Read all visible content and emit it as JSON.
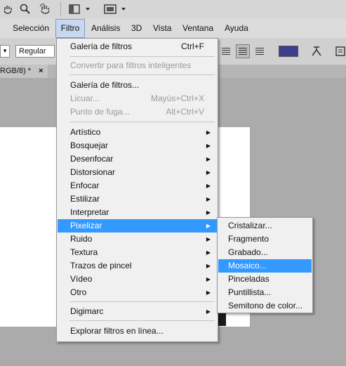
{
  "menubar": {
    "items": [
      "Selección",
      "Filtro",
      "Análisis",
      "3D",
      "Vista",
      "Ventana",
      "Ayuda"
    ]
  },
  "options": {
    "font_style": "Regular"
  },
  "document_tab": {
    "label": "RGB/8) *",
    "close": "×"
  },
  "colors": {
    "text_swatch": "#3c3f8e",
    "highlight": "#3399ff"
  },
  "filter_menu": {
    "items": [
      {
        "label": "Galería de filtros",
        "shortcut": "Ctrl+F",
        "enabled": true
      },
      {
        "label": "Convertir para filtros inteligentes",
        "enabled": false
      },
      {
        "label": "Galería de filtros...",
        "enabled": true
      },
      {
        "label": "Licuar...",
        "shortcut": "Mayús+Ctrl+X",
        "enabled": false
      },
      {
        "label": "Punto de fuga...",
        "shortcut": "Alt+Ctrl+V",
        "enabled": false
      },
      {
        "label": "Artístico",
        "submenu": true
      },
      {
        "label": "Bosquejar",
        "submenu": true
      },
      {
        "label": "Desenfocar",
        "submenu": true
      },
      {
        "label": "Distorsionar",
        "submenu": true
      },
      {
        "label": "Enfocar",
        "submenu": true
      },
      {
        "label": "Estilizar",
        "submenu": true
      },
      {
        "label": "Interpretar",
        "submenu": true
      },
      {
        "label": "Pixelizar",
        "submenu": true,
        "highlighted": true
      },
      {
        "label": "Ruido",
        "submenu": true
      },
      {
        "label": "Textura",
        "submenu": true
      },
      {
        "label": "Trazos de pincel",
        "submenu": true
      },
      {
        "label": "Vídeo",
        "submenu": true
      },
      {
        "label": "Otro",
        "submenu": true
      },
      {
        "label": "Digimarc",
        "submenu": true
      },
      {
        "label": "Explorar filtros en línea...",
        "enabled": true
      }
    ]
  },
  "pixelizar_submenu": {
    "items": [
      {
        "label": "Cristalizar..."
      },
      {
        "label": "Fragmento"
      },
      {
        "label": "Grabado..."
      },
      {
        "label": "Mosaico...",
        "highlighted": true
      },
      {
        "label": "Pinceladas"
      },
      {
        "label": "Puntillista..."
      },
      {
        "label": "Semitono de color..."
      }
    ]
  }
}
